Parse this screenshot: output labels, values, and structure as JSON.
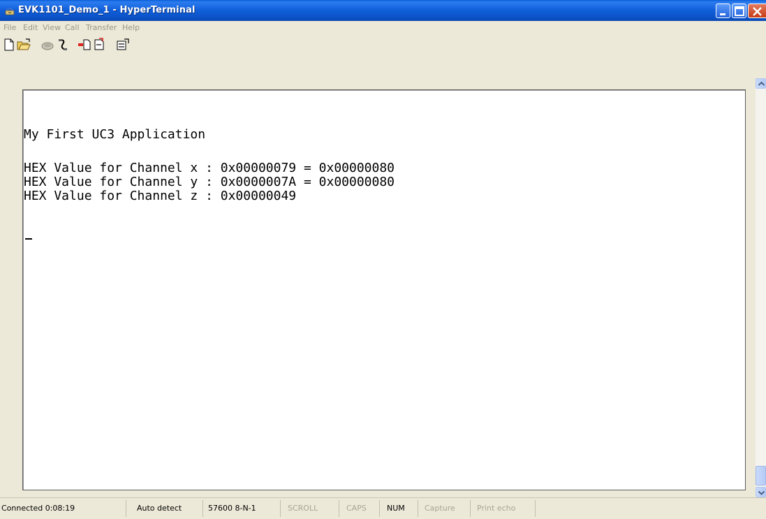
{
  "window": {
    "title": "EVK1101_Demo_1 - HyperTerminal",
    "icon": "hyperterminal-phone-icon",
    "controls": [
      "minimize-icon",
      "maximize-icon",
      "close-icon"
    ]
  },
  "menu": {
    "file": "File",
    "edit": "Edit",
    "view": "View",
    "call": "Call",
    "transfer": "Transfer",
    "help": "Help"
  },
  "toolbar": {
    "icons": [
      "new-icon",
      "open-icon",
      "call-icon",
      "disconnect-icon",
      "send-icon",
      "receive-icon",
      "properties-icon"
    ]
  },
  "terminal": {
    "lines": [
      "My First UC3 Application",
      "HEX Value for Channel x : 0x00000079 = 0x00000080",
      "HEX Value for Channel y : 0x0000007A = 0x00000080",
      "HEX Value for Channel z : 0x00000049"
    ],
    "cursor": "_"
  },
  "status": {
    "connected": "Connected 0:08:19",
    "detect": "Auto detect",
    "settings": "57600 8-N-1",
    "scroll": "SCROLL",
    "caps": "CAPS",
    "num": "NUM",
    "capture": "Capture",
    "print_echo": "Print echo"
  }
}
